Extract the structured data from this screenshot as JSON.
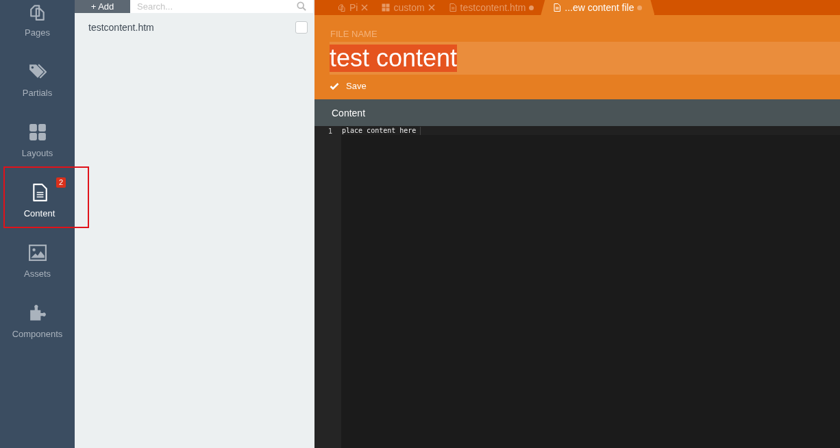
{
  "sidebar": {
    "items": [
      {
        "label": "Pages",
        "kind": "pages",
        "selected": false,
        "highlighted": false
      },
      {
        "label": "Partials",
        "kind": "tags",
        "selected": false,
        "highlighted": false
      },
      {
        "label": "Layouts",
        "kind": "grid",
        "selected": false,
        "highlighted": false
      },
      {
        "label": "Content",
        "kind": "file",
        "selected": true,
        "badge": "2",
        "highlighted": true
      },
      {
        "label": "Assets",
        "kind": "image",
        "selected": false,
        "highlighted": false
      },
      {
        "label": "Components",
        "kind": "puzzle",
        "selected": false,
        "highlighted": false
      }
    ]
  },
  "list": {
    "add_button": "+ Add",
    "search": {
      "placeholder": "Search..."
    },
    "items": [
      {
        "name": "testcontent.htm",
        "checked": false
      }
    ]
  },
  "tabs": [
    {
      "label": "Pi",
      "kind": "pages",
      "selected": false,
      "modified": false
    },
    {
      "label": "custom",
      "kind": "grid",
      "selected": false,
      "modified": false
    },
    {
      "label": "testcontent.htm",
      "kind": "file",
      "selected": false,
      "modified": true
    },
    {
      "label": "...ew content file",
      "kind": "file",
      "selected": true,
      "modified": true
    }
  ],
  "form": {
    "file_name_label": "FILE NAME",
    "file_name_value": "test content",
    "save_button": "Save"
  },
  "editor": {
    "title": "Content",
    "lines": [
      {
        "number": "1",
        "text": "place content here"
      }
    ]
  }
}
